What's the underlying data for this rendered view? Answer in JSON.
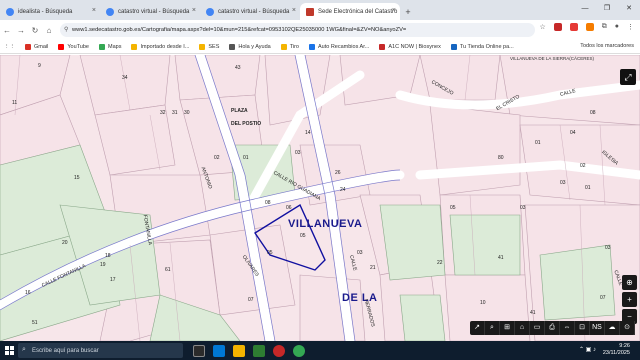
{
  "tabs": [
    {
      "label": "idealista - Búsqueda",
      "active": false
    },
    {
      "label": "catastro virtual - Búsqueda",
      "active": false
    },
    {
      "label": "catastro virtual - Búsqueda",
      "active": false
    },
    {
      "label": "Sede Electrónica del Catastro",
      "active": true
    }
  ],
  "address": {
    "url": "www1.sedecatastro.gob.es/Cartografia/mapa.aspx?del=10&mun=215&refcat=0953102QE25035000 1WG&final=&ZV=NO&anyoZV="
  },
  "bookmarks": [
    {
      "label": "Gmail",
      "color": "#d93025"
    },
    {
      "label": "YouTube",
      "color": "#ff0000"
    },
    {
      "label": "Maps",
      "color": "#34a853"
    },
    {
      "label": "Importado desde I...",
      "color": "#f4b400"
    },
    {
      "label": "SES",
      "color": "#f4b400"
    },
    {
      "label": "Hola y Ayuda",
      "color": "#555555"
    },
    {
      "label": "Tiro",
      "color": "#f4b400"
    },
    {
      "label": "Auto Recambios Ar...",
      "color": "#1a73e8"
    },
    {
      "label": "A1C NOW | Biosynex",
      "color": "#c62828"
    },
    {
      "label": "Tu Tienda Online pa...",
      "color": "#1565c0"
    }
  ],
  "bookmarks_all": "Todos los marcadores",
  "map": {
    "header": "VILLANUEVA DE LA SIERRA(CÁCERES)",
    "town_label_1": "VILLANUEVA",
    "town_label_2": "DE  LA",
    "plaza_1": "PLAZA",
    "plaza_2": "DEL POSTIO",
    "streets": [
      "CALLE FONTANILLA",
      "FONTANILLA",
      "ANTONIO",
      "CALLE",
      "CALLE",
      "EL CRISTO",
      "CONCEJO",
      "CALLE RIO GUADIANA",
      "OLIVARES",
      "HERRADOS",
      "IGLESIA",
      "CALLE"
    ],
    "parcel_numbers": [
      "9",
      "11",
      "15",
      "20",
      "19",
      "18",
      "17",
      "16",
      "51",
      "61",
      "32",
      "31",
      "30",
      "34",
      "43",
      "26",
      "24",
      "14",
      "03",
      "02",
      "01",
      "05",
      "08",
      "06",
      "03",
      "21",
      "22",
      "41",
      "05",
      "07",
      "80",
      "03",
      "03",
      "10",
      "41",
      "03",
      "02",
      "01",
      "04",
      "01",
      "05",
      "12",
      "07",
      "08"
    ],
    "controls": [
      "↗",
      "⌕",
      "⊞",
      "⌂",
      "▭",
      "⎙",
      "⇔",
      "⊡",
      "NS",
      "☁",
      "⊙"
    ],
    "right_controls": [
      "⊕",
      "+",
      "−"
    ]
  },
  "taskbar": {
    "search_placeholder": "Escribe aquí para buscar",
    "time": "9:26",
    "date": "23/11/2025"
  }
}
